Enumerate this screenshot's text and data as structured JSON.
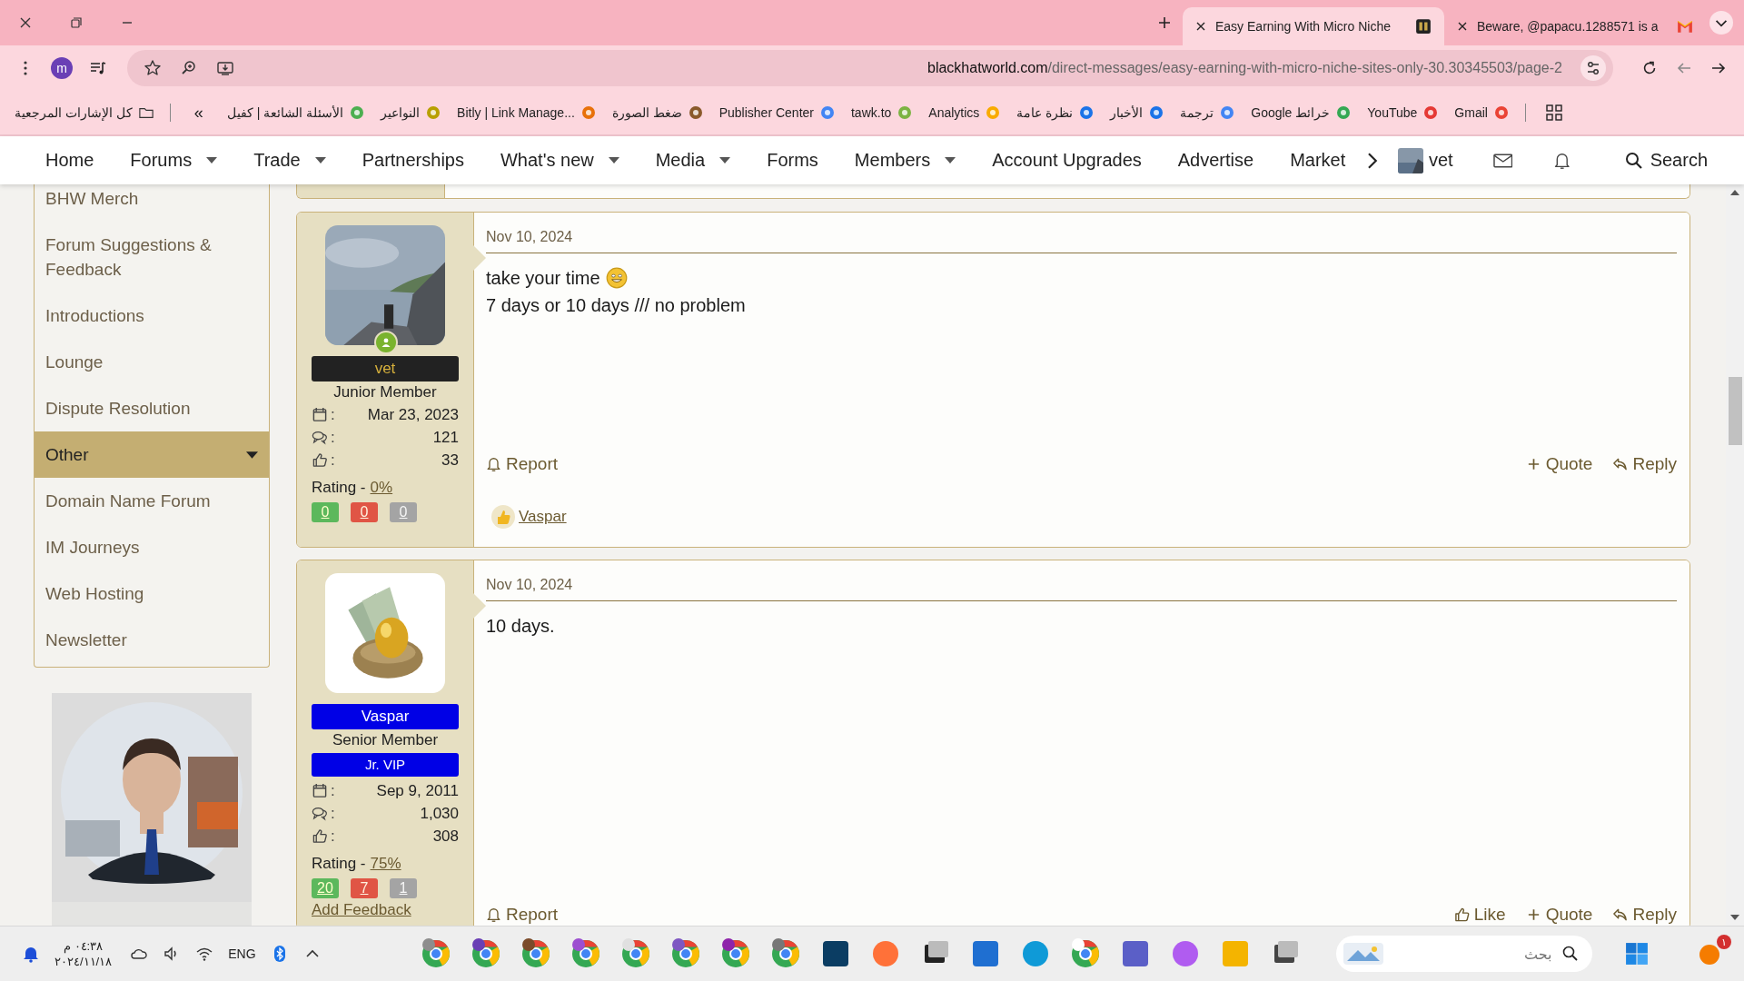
{
  "browser": {
    "tabs": [
      {
        "title": "Easy Earning With Micro Niche",
        "selected": true
      },
      {
        "title": "Beware, @papacu.1288571 is a",
        "selected": false
      }
    ],
    "profile_initial": "m",
    "url_host": "blackhatworld.com",
    "url_path": "/direct-messages/easy-earning-with-micro-niche-sites-only-30.30345503/page-2",
    "all_bookmarks": "كل الإشارات المرجعية",
    "overflow": "«",
    "bookmarks": [
      {
        "label": "الأسئلة الشائعة | كفيل"
      },
      {
        "label": "النواعير"
      },
      {
        "label": "Bitly | Link Manage..."
      },
      {
        "label": "ضغط الصورة"
      },
      {
        "label": "Publisher Center"
      },
      {
        "label": "tawk.to"
      },
      {
        "label": "Analytics"
      },
      {
        "label": "نظرة عامة"
      },
      {
        "label": "الأخبار"
      },
      {
        "label": "ترجمة"
      },
      {
        "label": "Google خرائط"
      },
      {
        "label": "YouTube"
      },
      {
        "label": "Gmail"
      }
    ]
  },
  "nav": {
    "items": [
      {
        "label": "Home",
        "dropdown": false
      },
      {
        "label": "Forums",
        "dropdown": true
      },
      {
        "label": "Trade",
        "dropdown": true
      },
      {
        "label": "Partnerships",
        "dropdown": false
      },
      {
        "label": "What's new",
        "dropdown": true
      },
      {
        "label": "Media",
        "dropdown": true
      },
      {
        "label": "Forms",
        "dropdown": false
      },
      {
        "label": "Members",
        "dropdown": true
      },
      {
        "label": "Account Upgrades",
        "dropdown": false
      },
      {
        "label": "Advertise",
        "dropdown": false
      },
      {
        "label": "Market",
        "dropdown": false
      }
    ],
    "user": "vet",
    "search": "Search"
  },
  "sidebar": [
    {
      "label": "BHW Merch",
      "kind": "link"
    },
    {
      "label": "Forum Suggestions & Feedback",
      "kind": "link"
    },
    {
      "label": "Introductions",
      "kind": "link"
    },
    {
      "label": "Lounge",
      "kind": "link"
    },
    {
      "label": "Dispute Resolution",
      "kind": "link"
    },
    {
      "label": "Other",
      "kind": "category"
    },
    {
      "label": "Domain Name Forum",
      "kind": "link"
    },
    {
      "label": "IM Journeys",
      "kind": "link"
    },
    {
      "label": "Web Hosting",
      "kind": "link"
    },
    {
      "label": "Newsletter",
      "kind": "link"
    }
  ],
  "posts": [
    {
      "date": "Nov 10, 2024",
      "lines": [
        {
          "text": "take your time",
          "smiley": true
        },
        {
          "text": "7 days or 10 days /// no problem",
          "smiley": false
        }
      ],
      "author": {
        "name": "vet",
        "kind": "dark",
        "online": true,
        "title": "Junior Member",
        "stats": [
          {
            "kind": "joined",
            "separator": ":",
            "value": "Mar 23, 2023"
          },
          {
            "kind": "messages",
            "separator": ":",
            "value": "121"
          },
          {
            "kind": "reactions",
            "separator": ":",
            "value": "33"
          }
        ],
        "rating_label": "Rating -",
        "rating": "0%",
        "feedback": [
          {
            "kind": "positive",
            "count": "0"
          },
          {
            "kind": "negative",
            "count": "0"
          },
          {
            "kind": "neutral",
            "count": "0"
          }
        ]
      },
      "actions_left": [
        {
          "kind": "report",
          "label": "Report"
        }
      ],
      "actions_right": [
        {
          "kind": "quote",
          "label": "Quote"
        },
        {
          "kind": "reply",
          "label": "Reply"
        }
      ],
      "liked_by": "Vaspar"
    },
    {
      "date": "Nov 10, 2024",
      "lines": [
        {
          "text": "10 days.",
          "smiley": false
        }
      ],
      "author": {
        "name": "Vaspar",
        "kind": "blue",
        "online": false,
        "title": "Senior Member",
        "banner": "Jr. VIP",
        "stats": [
          {
            "kind": "joined",
            "separator": ":",
            "value": "Sep 9, 2011"
          },
          {
            "kind": "messages",
            "separator": ":",
            "value": "1,030"
          },
          {
            "kind": "reactions",
            "separator": ":",
            "value": "308"
          }
        ],
        "rating_label": "Rating -",
        "rating": "75%",
        "feedback": [
          {
            "kind": "positive",
            "count": "20"
          },
          {
            "kind": "negative",
            "count": "7"
          },
          {
            "kind": "neutral",
            "count": "1"
          }
        ],
        "add_feedback": "Add Feedback"
      },
      "actions_left": [
        {
          "kind": "report",
          "label": "Report"
        }
      ],
      "actions_right": [
        {
          "kind": "like",
          "label": "Like"
        },
        {
          "kind": "quote",
          "label": "Quote"
        },
        {
          "kind": "reply",
          "label": "Reply"
        }
      ]
    }
  ],
  "taskbar": {
    "time": "٠٤:٣٨ م",
    "date": "٢٠٢٤/١١/١٨",
    "language": "ENG",
    "search_placeholder": "بحث",
    "notification_count": "١"
  }
}
